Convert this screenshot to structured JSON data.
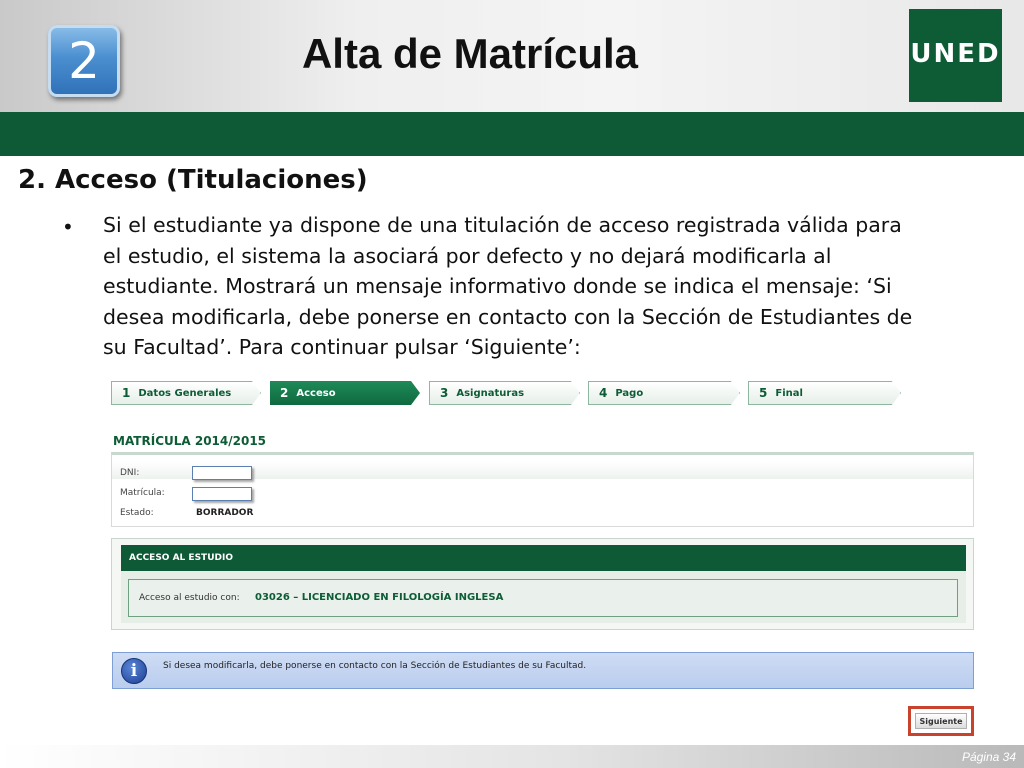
{
  "header": {
    "badge_number": "2",
    "title": "Alta de Matrícula",
    "logo_text": "UNED"
  },
  "section": {
    "heading": "2.  Acceso (Titulaciones)",
    "bullet": "•",
    "paragraph": "Si el estudiante ya dispone de una titulación de acceso registrada válida para el estudio, el sistema la asociará por defecto y no dejará modificarla al estudiante. Mostrará un mensaje informativo donde se indica el mensaje: ‘Si desea modificarla, debe ponerse en contacto con la Sección de Estudiantes de su Facultad’. Para continuar pulsar ‘Siguiente’:"
  },
  "steps": [
    {
      "number": "1",
      "label": "Datos Generales",
      "active": false
    },
    {
      "number": "2",
      "label": "Acceso",
      "active": true
    },
    {
      "number": "3",
      "label": "Asignaturas",
      "active": false
    },
    {
      "number": "4",
      "label": "Pago",
      "active": false
    },
    {
      "number": "5",
      "label": "Final",
      "active": false
    }
  ],
  "form": {
    "title": "MATRÍCULA 2014/2015",
    "dni_label": "DNI:",
    "dni_value": "",
    "matricula_label": "Matrícula:",
    "matricula_value": "",
    "estado_label": "Estado:",
    "estado_value": "BORRADOR"
  },
  "access": {
    "header": "ACCESO AL ESTUDIO",
    "label": "Acceso al estudio con:",
    "value": "03026 – LICENCIADO EN FILOLOGÍA INGLESA"
  },
  "info": {
    "icon": "info-icon",
    "message": "Si desea modificarla, debe ponerse en contacto con la Sección de Estudiantes de su Facultad."
  },
  "buttons": {
    "next_label": "Siguiente"
  },
  "footer": {
    "page_label": "Página 34"
  },
  "colors": {
    "brand_green": "#0e5a37",
    "badge_blue": "#3a7cc4",
    "highlight_red": "#c9432c",
    "info_blue": "#c3d4f1"
  }
}
